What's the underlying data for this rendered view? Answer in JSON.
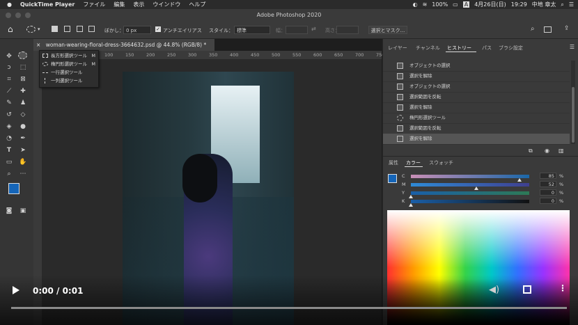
{
  "menubar": {
    "apple": "",
    "app_name": "QuickTime Player",
    "items": [
      "ファイル",
      "編集",
      "表示",
      "ウインドウ",
      "ヘルプ"
    ],
    "battery": "100%",
    "input": "A",
    "date": "4月26日(日)",
    "time": "19:29",
    "user": "中地 章太"
  },
  "window": {
    "title": "Adobe Photoshop 2020"
  },
  "options_bar": {
    "feather_label": "ぼかし：",
    "feather_value": "0 px",
    "antialias_label": "アンチエイリアス",
    "antialias_checked": true,
    "style_label": "スタイル：",
    "style_value": "標準",
    "width_label": "幅：",
    "height_label": "高さ：",
    "select_mask_label": "選択とマスク..."
  },
  "flyout": {
    "items": [
      {
        "label": "長方形選択ツール",
        "shortcut": "M"
      },
      {
        "label": "楕円形選択ツール",
        "shortcut": "M"
      },
      {
        "label": "一行選択ツール",
        "shortcut": ""
      },
      {
        "label": "一列選択ツール",
        "shortcut": ""
      }
    ]
  },
  "document": {
    "tab_title": "woman-wearing-floral-dress-3664632.psd @ 44.8% (RGB/8) *",
    "ruler_ticks": [
      "100",
      "150",
      "200",
      "250",
      "300",
      "350",
      "400",
      "450",
      "500",
      "550",
      "600",
      "650",
      "700",
      "750",
      "800"
    ]
  },
  "panels": {
    "top_tabs": [
      "レイヤー",
      "チャンネル",
      "ヒストリー",
      "パス",
      "ブラシ設定"
    ],
    "active_top_tab": "ヒストリー",
    "history": [
      "オブジェクトの選択",
      "選択を解除",
      "オブジェクトの選択",
      "選択範囲を反転",
      "選択を解除",
      "楕円形選択ツール",
      "選択範囲を反転",
      "選択を解除"
    ],
    "bottom_tabs": [
      "属性",
      "カラー",
      "スウォッチ"
    ],
    "active_bottom_tab": "カラー",
    "cmyk": [
      {
        "channel": "C",
        "value": "85"
      },
      {
        "channel": "M",
        "value": "52"
      },
      {
        "channel": "Y",
        "value": "0"
      },
      {
        "channel": "K",
        "value": "0"
      }
    ],
    "percent": "%"
  },
  "colors": {
    "foreground": "#1565b8",
    "background": "#ffffff"
  },
  "video": {
    "time": "0:00 / 0:01",
    "progress": 0
  }
}
